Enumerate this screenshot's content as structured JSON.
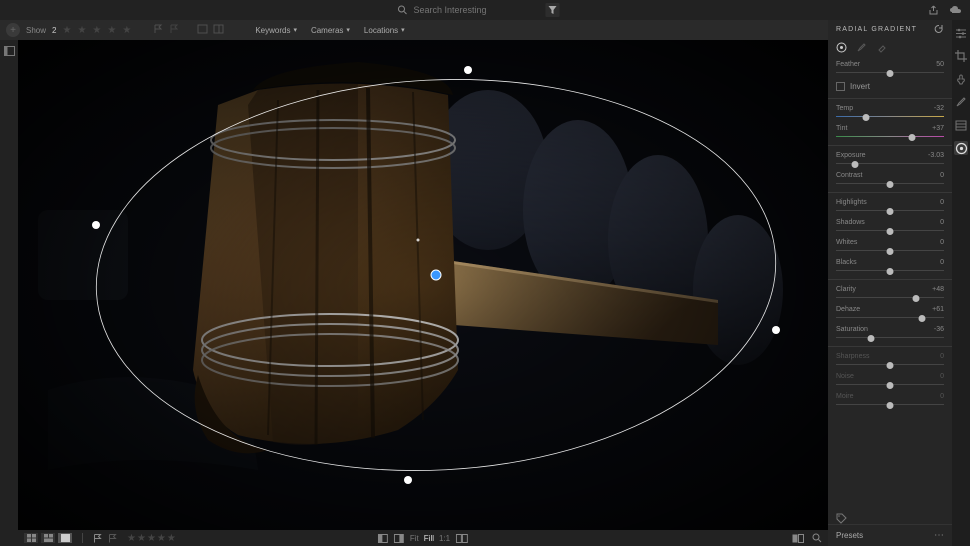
{
  "search": {
    "placeholder": "Search Interesting"
  },
  "secondbar": {
    "show_label": "Show",
    "count": "2",
    "dropdowns": {
      "keywords": "Keywords",
      "cameras": "Cameras",
      "locations": "Locations"
    }
  },
  "panel": {
    "title": "RADIAL GRADIENT",
    "invert_label": "Invert",
    "sliders": {
      "feather": {
        "label": "Feather",
        "value": "50",
        "pos": 50
      },
      "temp": {
        "label": "Temp",
        "value": "-32",
        "pos": 28
      },
      "tint": {
        "label": "Tint",
        "value": "+37",
        "pos": 70
      },
      "exposure": {
        "label": "Exposure",
        "value": "-3.03",
        "pos": 18
      },
      "contrast": {
        "label": "Contrast",
        "value": "0",
        "pos": 50
      },
      "highlights": {
        "label": "Highlights",
        "value": "0",
        "pos": 50
      },
      "shadows": {
        "label": "Shadows",
        "value": "0",
        "pos": 50
      },
      "whites": {
        "label": "Whites",
        "value": "0",
        "pos": 50
      },
      "blacks": {
        "label": "Blacks",
        "value": "0",
        "pos": 50
      },
      "clarity": {
        "label": "Clarity",
        "value": "+48",
        "pos": 74
      },
      "dehaze": {
        "label": "Dehaze",
        "value": "+61",
        "pos": 80
      },
      "saturation": {
        "label": "Saturation",
        "value": "-36",
        "pos": 32
      },
      "sharpness": {
        "label": "Sharpness",
        "value": "0",
        "pos": 50
      },
      "noise": {
        "label": "Noise",
        "value": "0",
        "pos": 50
      },
      "moire": {
        "label": "Moire",
        "value": "0",
        "pos": 50
      }
    }
  },
  "bottom": {
    "fit": "Fit",
    "fill": "Fill",
    "oneone": "1:1"
  },
  "presets": {
    "label": "Presets"
  }
}
